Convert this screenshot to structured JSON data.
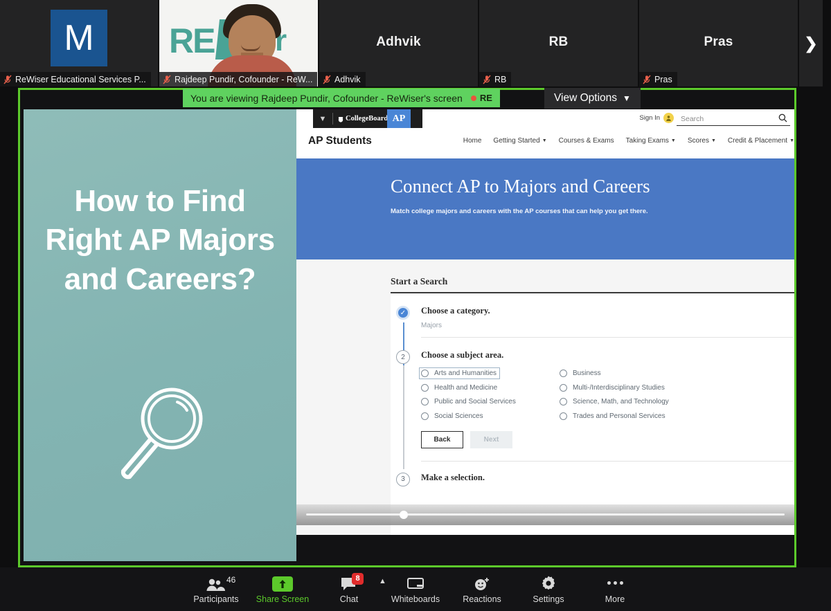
{
  "filmstrip": {
    "tiles": [
      {
        "kind": "avatar",
        "initial": "M",
        "label": "ReWiser Educational Services P...",
        "muted": true,
        "center_name": ""
      },
      {
        "kind": "video",
        "initial": "",
        "label": "Rajdeep Pundir, Cofounder - ReW...",
        "muted": true,
        "center_name": ""
      },
      {
        "kind": "name",
        "initial": "",
        "label": "Adhvik",
        "muted": true,
        "center_name": "Adhvik"
      },
      {
        "kind": "name",
        "initial": "",
        "label": "RB",
        "muted": true,
        "center_name": "RB"
      },
      {
        "kind": "name",
        "initial": "",
        "label": "Pras",
        "muted": true,
        "center_name": "Pras"
      }
    ],
    "next_arrow_icon": "chevron-right-icon"
  },
  "share": {
    "viewing_banner": "You are viewing Rajdeep Pundir, Cofounder - ReWiser's screen",
    "recording_label": "RE",
    "view_options_label": "View Options",
    "view_options_chevron": "chevron-down-icon",
    "border_color": "#5cc92b",
    "banner_color": "#5fd25f"
  },
  "slide": {
    "title": "How to Find Right AP Majors and Careers?",
    "icon": "magnifying-glass-icon",
    "background_color": "#83b4b2",
    "text_color": "#ffffff"
  },
  "website": {
    "topbar": {
      "caret_icon": "chevron-down-icon",
      "brand": "CollegeBoard",
      "acorn_icon": "acorn-icon",
      "ap_badge": "AP",
      "sign_in_label": "Sign In",
      "avatar_icon": "user-avatar-icon",
      "search_placeholder": "Search",
      "search_icon": "search-icon"
    },
    "nav": {
      "brand": "AP Students",
      "items": [
        {
          "label": "Home",
          "caret": false
        },
        {
          "label": "Getting Started",
          "caret": true
        },
        {
          "label": "Courses & Exams",
          "caret": false
        },
        {
          "label": "Taking Exams",
          "caret": true
        },
        {
          "label": "Scores",
          "caret": true
        },
        {
          "label": "Credit & Placement",
          "caret": true
        }
      ]
    },
    "hero": {
      "title": "Connect AP to Majors and Careers",
      "subtitle": "Match college majors and careers with the AP courses that can help you get there.",
      "background_color": "#4a78c4"
    },
    "search_panel": {
      "heading": "Start a Search",
      "step1": {
        "number": "1",
        "state": "complete",
        "check_icon": "check-icon",
        "title": "Choose a category.",
        "value": "Majors"
      },
      "step2": {
        "number": "2",
        "state": "active",
        "title": "Choose a subject area.",
        "options": [
          {
            "label": "Arts and Humanities",
            "selected": false,
            "focused": true
          },
          {
            "label": "Business",
            "selected": false,
            "focused": false
          },
          {
            "label": "Health and Medicine",
            "selected": false,
            "focused": false
          },
          {
            "label": "Multi-/Interdisciplinary Studies",
            "selected": false,
            "focused": false
          },
          {
            "label": "Public and Social Services",
            "selected": false,
            "focused": false
          },
          {
            "label": "Science, Math, and Technology",
            "selected": false,
            "focused": false
          },
          {
            "label": "Social Sciences",
            "selected": false,
            "focused": false
          },
          {
            "label": "Trades and Personal Services",
            "selected": false,
            "focused": false
          }
        ],
        "back_label": "Back",
        "next_label": "Next",
        "next_disabled": true
      },
      "step3": {
        "number": "3",
        "state": "pending",
        "title": "Make a selection."
      }
    },
    "player": {
      "seek_progress_percent": 20,
      "handle_icon": "seek-handle-icon"
    },
    "cursor_icon": "mouse-pointer-icon"
  },
  "toolbar": {
    "items": [
      {
        "label": "Participants",
        "icon": "participants-icon",
        "count": "46",
        "badge": "",
        "green": false,
        "caret": false
      },
      {
        "label": "Share Screen",
        "icon": "share-screen-icon",
        "count": "",
        "badge": "",
        "green": true,
        "caret": false
      },
      {
        "label": "Chat",
        "icon": "chat-icon",
        "count": "",
        "badge": "8",
        "green": false,
        "caret": true
      },
      {
        "label": "Whiteboards",
        "icon": "whiteboard-icon",
        "count": "",
        "badge": "",
        "green": false,
        "caret": false
      },
      {
        "label": "Reactions",
        "icon": "reactions-icon",
        "count": "",
        "badge": "",
        "green": false,
        "caret": false
      },
      {
        "label": "Settings",
        "icon": "gear-icon",
        "count": "",
        "badge": "",
        "green": false,
        "caret": false
      },
      {
        "label": "More",
        "icon": "more-dots-icon",
        "count": "",
        "badge": "",
        "green": false,
        "caret": false
      }
    ]
  }
}
